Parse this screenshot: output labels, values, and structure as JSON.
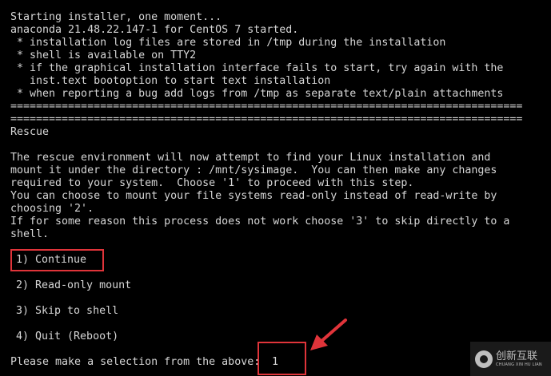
{
  "header": {
    "lines": [
      "Starting installer, one moment...",
      "anaconda 21.48.22.147-1 for CentOS 7 started.",
      " * installation log files are stored in /tmp during the installation",
      " * shell is available on TTY2",
      " * if the graphical installation interface fails to start, try again with the",
      "   inst.text bootoption to start text installation",
      " * when reporting a bug add logs from /tmp as separate text/plain attachments"
    ]
  },
  "separator": "================================================================================",
  "rescue": {
    "title": "Rescue",
    "paragraph_lines": [
      "The rescue environment will now attempt to find your Linux installation and",
      "mount it under the directory : /mnt/sysimage.  You can then make any changes",
      "required to your system.  Choose '1' to proceed with this step.",
      "You can choose to mount your file systems read-only instead of read-write by",
      "choosing '2'.",
      "If for some reason this process does not work choose '3' to skip directly to a",
      "shell."
    ],
    "options": [
      "1) Continue",
      "2) Read-only mount",
      "3) Skip to shell",
      "4) Quit (Reboot)"
    ],
    "prompt": "Please make a selection from the above:",
    "input_value": "1"
  },
  "colors": {
    "background": "#000000",
    "text": "#d6d6d6",
    "highlight": "#e0343a"
  },
  "annotation": {
    "arrow_icon": "red-arrow-icon"
  },
  "watermark": {
    "brand_cn": "创新互联",
    "brand_en": "CHUANG XIN HU LIAN"
  }
}
